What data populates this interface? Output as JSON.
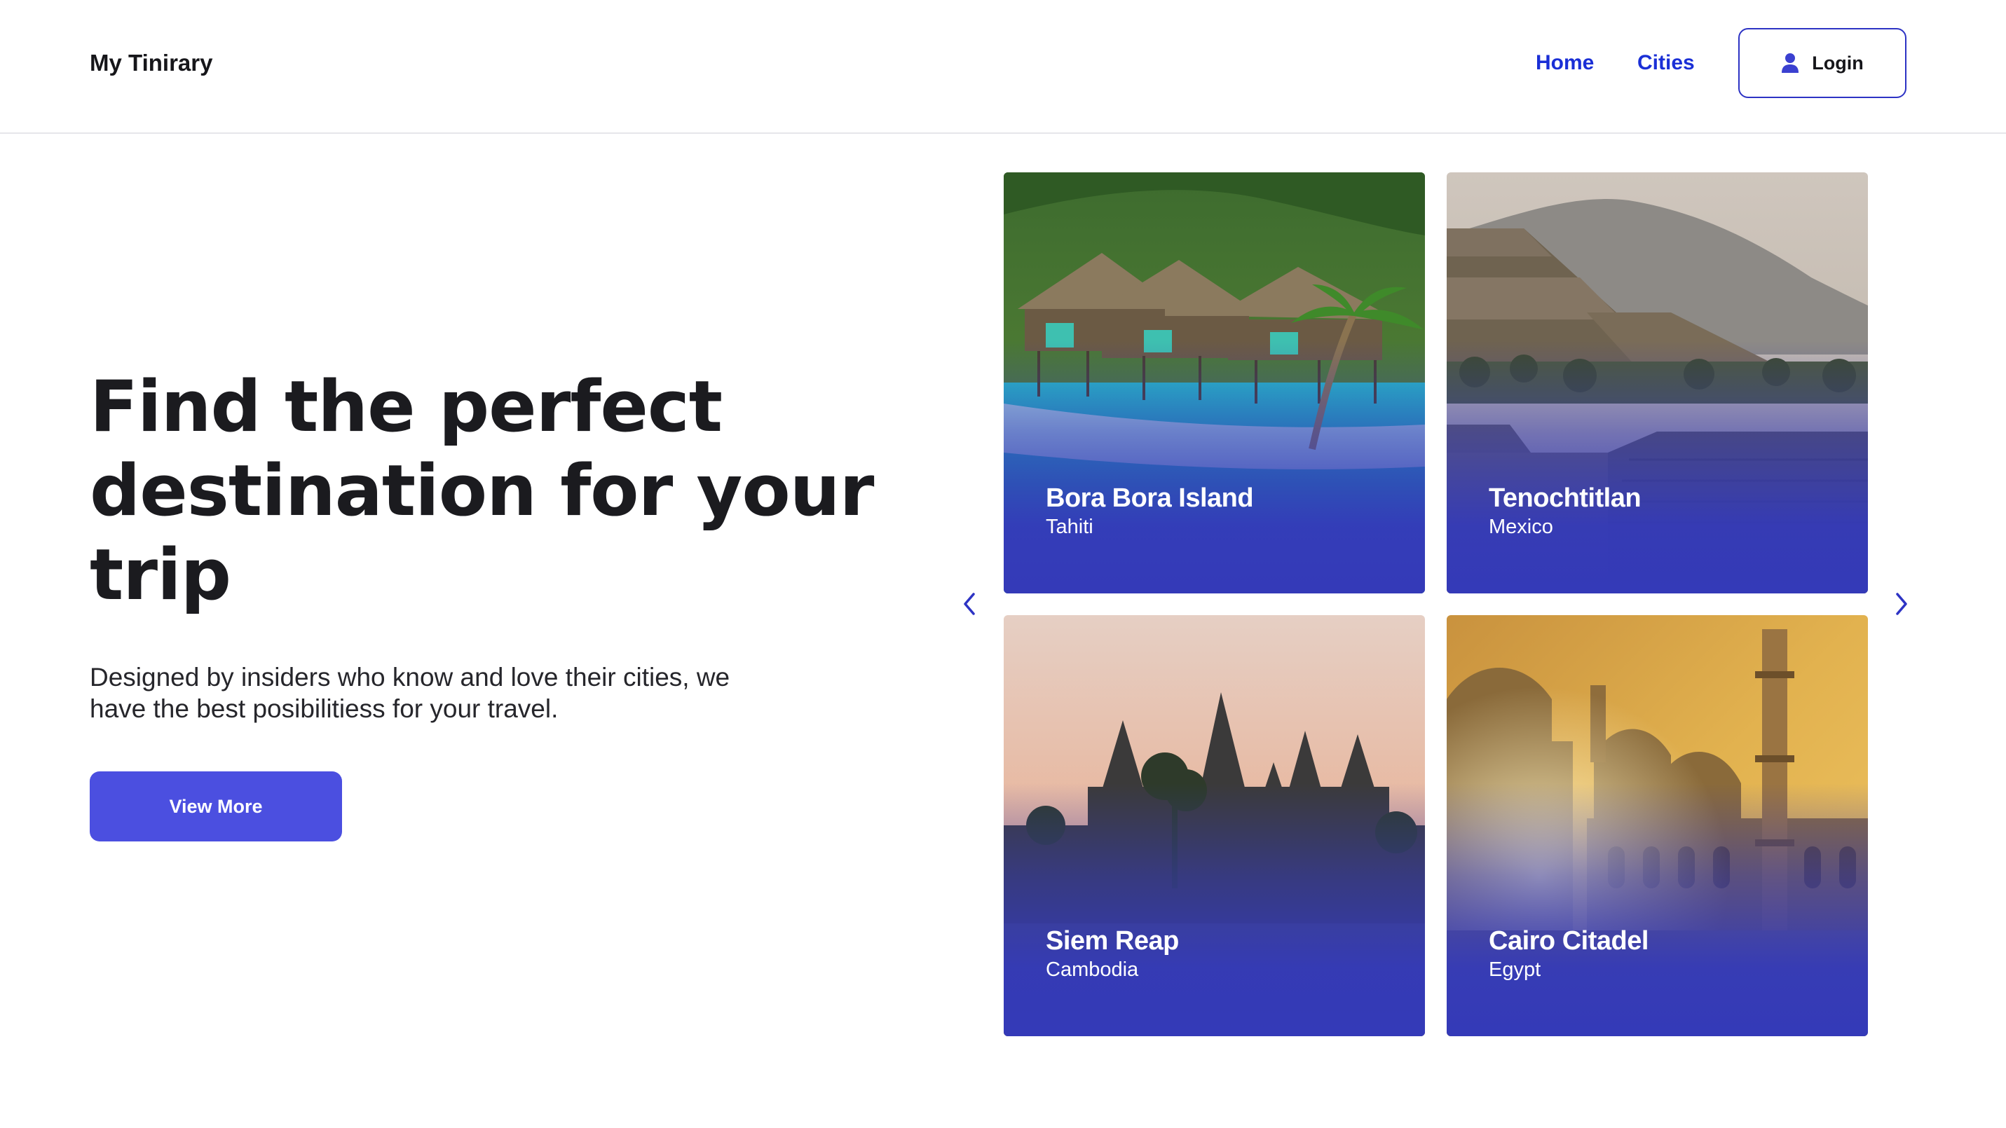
{
  "header": {
    "brand": "My Tinirary",
    "nav": {
      "home": "Home",
      "cities": "Cities"
    },
    "login_label": "Login",
    "login_icon": "user-icon"
  },
  "hero": {
    "title": "Find the perfect destination for your trip",
    "subtitle": "Designed by insiders who know and love their cities, we have the best posibilitiess for your travel.",
    "cta_label": "View More"
  },
  "carousel": {
    "prev_icon": "chevron-left-icon",
    "next_icon": "chevron-right-icon",
    "cards": [
      {
        "name": "Bora Bora Island",
        "country": "Tahiti"
      },
      {
        "name": "Tenochtitlan",
        "country": "Mexico"
      },
      {
        "name": "Siem Reap",
        "country": "Cambodia"
      },
      {
        "name": "Cairo Citadel",
        "country": "Egypt"
      }
    ]
  },
  "colors": {
    "accent": "#4b4fe0",
    "nav_link": "#1a2fd6",
    "card_overlay": "#343ab8",
    "text_dark": "#1b1b1f"
  }
}
